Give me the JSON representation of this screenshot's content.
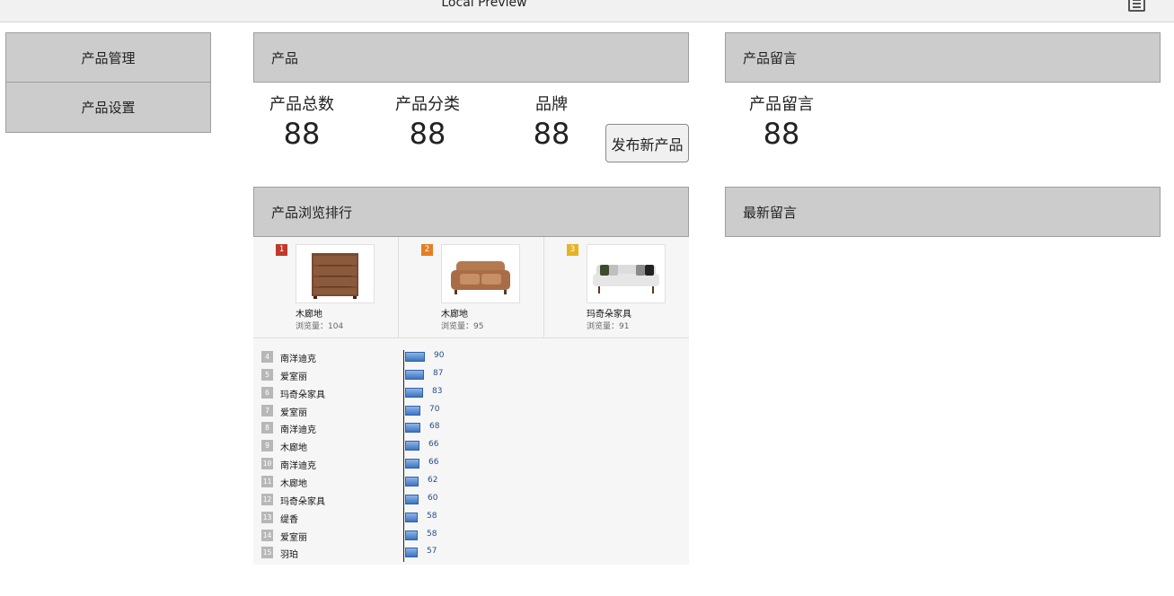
{
  "window": {
    "title": "Local Preview",
    "menu_icon": "list-icon"
  },
  "sidebar": {
    "items": [
      {
        "label": "产品管理"
      },
      {
        "label": "产品设置"
      }
    ]
  },
  "product_panel": {
    "header": "产品",
    "stats": [
      {
        "label": "产品总数",
        "value": "88"
      },
      {
        "label": "产品分类",
        "value": "88"
      },
      {
        "label": "品牌",
        "value": "88"
      }
    ],
    "publish_button": "发布新产品"
  },
  "comments_panel": {
    "header": "产品留言",
    "stat": {
      "label": "产品留言",
      "value": "88"
    }
  },
  "ranking": {
    "header": "产品浏览排行",
    "top3": [
      {
        "rank": "1",
        "name": "木廊地",
        "views": "浏览量：104",
        "badge_color": "#c0392b",
        "image": "dresser-image"
      },
      {
        "rank": "2",
        "name": "木廊地",
        "views": "浏览量：95",
        "badge_color": "#e67e22",
        "image": "sofa-image"
      },
      {
        "rank": "3",
        "name": "玛奇朵家具",
        "views": "浏览量：91",
        "badge_color": "#e6b422",
        "image": "sofa-image"
      }
    ],
    "list": [
      {
        "rank": "4",
        "name": "南洋迪克",
        "value": 90
      },
      {
        "rank": "5",
        "name": "爱室丽",
        "value": 87
      },
      {
        "rank": "6",
        "name": "玛奇朵家具",
        "value": 83
      },
      {
        "rank": "7",
        "name": "爱室丽",
        "value": 70
      },
      {
        "rank": "8",
        "name": "南洋迪克",
        "value": 68
      },
      {
        "rank": "9",
        "name": "木廊地",
        "value": 66
      },
      {
        "rank": "10",
        "name": "南洋迪克",
        "value": 66
      },
      {
        "rank": "11",
        "name": "木廊地",
        "value": 62
      },
      {
        "rank": "12",
        "name": "玛奇朵家具",
        "value": 60
      },
      {
        "rank": "13",
        "name": "缇香",
        "value": 58
      },
      {
        "rank": "14",
        "name": "爱室丽",
        "value": 58
      },
      {
        "rank": "15",
        "name": "羽珀",
        "value": 57
      }
    ]
  },
  "latest_panel": {
    "header": "最新留言"
  }
}
